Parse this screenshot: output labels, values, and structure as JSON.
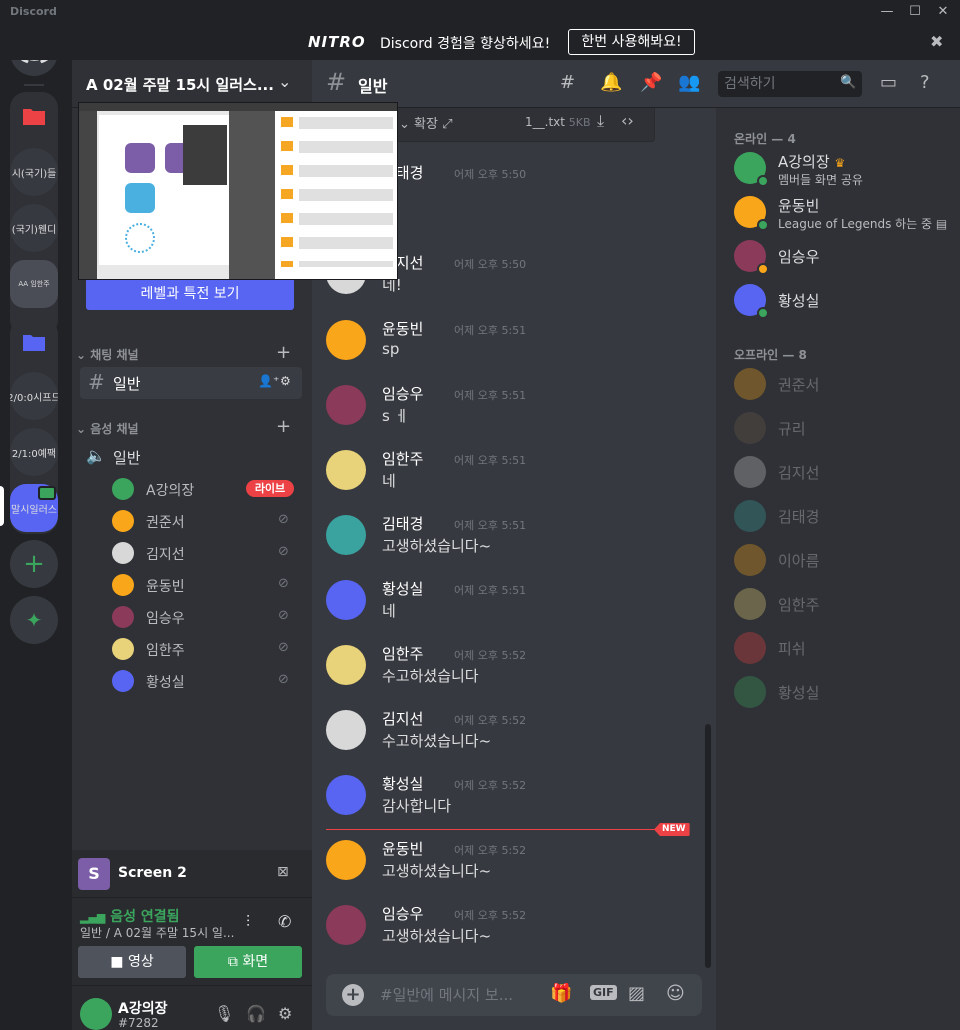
{
  "window": {
    "app_name": "Discord",
    "minimize": "—",
    "maximize": "☐",
    "close": "✕"
  },
  "nitro_banner": {
    "logo": "NITRO",
    "text": "Discord 경험을 향상하세요!",
    "button": "한번 사용해봐요!",
    "close": "✖"
  },
  "server_rail": {
    "servers": [
      "시(국기)들",
      "(국기)웬디",
      "2/0:0시프드",
      "2/1:0예팩",
      "말시일러스"
    ]
  },
  "guild": {
    "name": "A 02월 주말 15시 일러스...",
    "boost_button": "레벨과 특전 보기",
    "text_category": "채팅 채널",
    "voice_category": "음성 채널",
    "text_channel": "일반",
    "voice_channel": "일반",
    "voice_users": [
      {
        "name": "A강의장",
        "live": "라이브"
      },
      {
        "name": "권준서"
      },
      {
        "name": "김지선"
      },
      {
        "name": "윤동빈"
      },
      {
        "name": "임승우"
      },
      {
        "name": "임한주"
      },
      {
        "name": "황성실"
      }
    ]
  },
  "screen_share": {
    "initial": "S",
    "label": "Screen 2"
  },
  "voice_panel": {
    "status": "음성 연결됨",
    "sub": "일반 / A 02월 주말 15시 일...",
    "video_button": "영상",
    "screen_button": "화면"
  },
  "user_panel": {
    "username": "A강의장",
    "tag": "#7282"
  },
  "chat": {
    "channel_name": "일반",
    "search_placeholder": "검색하기",
    "attachment": {
      "expand": "확장",
      "filename": "1__.txt",
      "size": "5KB"
    },
    "messages": [
      {
        "author": "김태경",
        "time": "어제 오후 5:50",
        "text": ""
      },
      {
        "author": "김지선",
        "time": "어제 오후 5:50",
        "text": "네!"
      },
      {
        "author": "윤동빈",
        "time": "어제 오후 5:51",
        "text": "sp"
      },
      {
        "author": "임승우",
        "time": "어제 오후 5:51",
        "text": "s ㅔ"
      },
      {
        "author": "임한주",
        "time": "어제 오후 5:51",
        "text": "네"
      },
      {
        "author": "김태경",
        "time": "어제 오후 5:51",
        "text": "고생하셨습니다~"
      },
      {
        "author": "황성실",
        "time": "어제 오후 5:51",
        "text": "네"
      },
      {
        "author": "임한주",
        "time": "어제 오후 5:52",
        "text": "수고하셨습니다"
      },
      {
        "author": "김지선",
        "time": "어제 오후 5:52",
        "text": "수고하셨습니다~"
      },
      {
        "author": "황성실",
        "time": "어제 오후 5:52",
        "text": "감사합니다"
      },
      {
        "author": "윤동빈",
        "time": "어제 오후 5:52",
        "text": "고생하셨습니다~"
      },
      {
        "author": "임승우",
        "time": "어제 오후 5:52",
        "text": "고생하셨습니다~"
      }
    ],
    "new_tag": "NEW",
    "composer_placeholder": "#일반에 메시지 보...",
    "gif_label": "GIF"
  },
  "members": {
    "online_header": "온라인 — 4",
    "offline_header": "오프라인 — 8",
    "online": [
      {
        "name": "A강의장",
        "activity": "멤버들 화면 공유",
        "color": "#3ba55d"
      },
      {
        "name": "윤동빈",
        "activity": "League of Legends 하는 중",
        "color": "#faa61a"
      },
      {
        "name": "임승우",
        "activity": "",
        "color": "#8b3a5a"
      },
      {
        "name": "황성실",
        "activity": "",
        "color": "#5865f2"
      }
    ],
    "offline": [
      {
        "name": "권준서",
        "color": "#faa61a"
      },
      {
        "name": "규리",
        "color": "#6b5a4a"
      },
      {
        "name": "김지선",
        "color": "#c8c8c8"
      },
      {
        "name": "김태경",
        "color": "#3aa3a0"
      },
      {
        "name": "이아름",
        "color": "#faa61a"
      },
      {
        "name": "임한주",
        "color": "#e8d27a"
      },
      {
        "name": "피쉬",
        "color": "#ed4245"
      },
      {
        "name": "황성실",
        "color": "#3ba55d"
      }
    ]
  },
  "colors": {
    "blurple": "#5865f2",
    "green": "#3ba55d",
    "red": "#ed4245",
    "yellow": "#faa61a"
  }
}
